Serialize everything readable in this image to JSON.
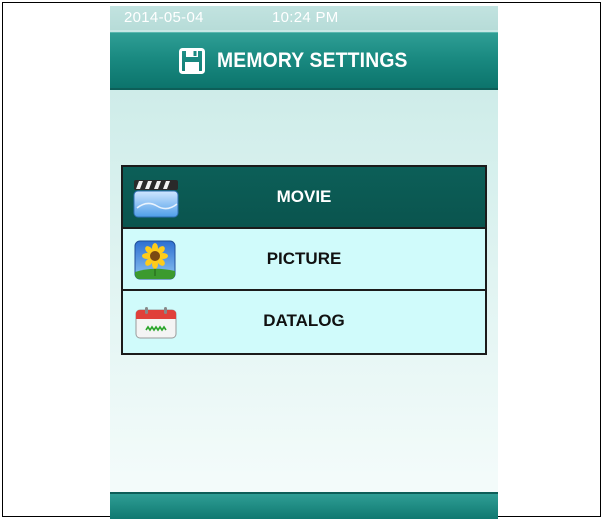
{
  "status_bar": {
    "date": "2014-05-04",
    "time": "10:24 PM"
  },
  "header": {
    "title": "MEMORY SETTINGS",
    "icon": "save-disk-icon"
  },
  "menu": {
    "items": [
      {
        "label": "MOVIE",
        "icon": "movie-clapper-icon",
        "selected": true
      },
      {
        "label": "PICTURE",
        "icon": "sunflower-picture-icon",
        "selected": false
      },
      {
        "label": "DATALOG",
        "icon": "datalog-calendar-icon",
        "selected": false
      }
    ]
  },
  "colors": {
    "accent": "#1a8a81",
    "selected_item": "#0c5f58",
    "item_background": "#d0fbfb"
  }
}
